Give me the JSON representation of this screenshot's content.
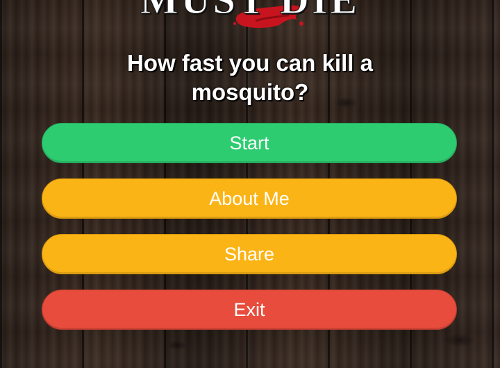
{
  "logo": {
    "text": "MUST DIE"
  },
  "question": "How fast you can kill a mosquito?",
  "buttons": {
    "start": "Start",
    "about": "About Me",
    "share": "Share",
    "exit": "Exit"
  },
  "colors": {
    "start": "#2ecc71",
    "about": "#fbb416",
    "share": "#fbb416",
    "exit": "#e74c3c",
    "splat": "#c8141e"
  }
}
